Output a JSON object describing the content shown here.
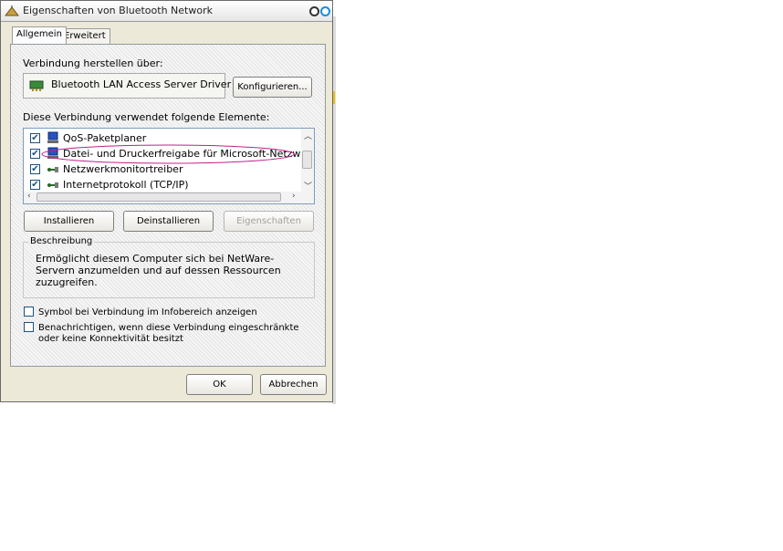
{
  "window": {
    "title": "Eigenschaften von Bluetooth Network"
  },
  "tabs": [
    {
      "label": "Allgemein",
      "active": true
    },
    {
      "label": "Erweitert",
      "active": false
    }
  ],
  "connection": {
    "label": "Verbindung herstellen über:",
    "adapter": "Bluetooth LAN Access Server Driver",
    "configure_button": "Konfigurieren..."
  },
  "elements": {
    "label": "Diese Verbindung verwendet folgende Elemente:",
    "items": [
      {
        "label": "QoS-Paketplaner",
        "checked": true,
        "icon": "network-service-icon"
      },
      {
        "label": "Datei- und Druckerfreigabe für Microsoft-Netzwerke",
        "checked": true,
        "icon": "network-client-icon"
      },
      {
        "label": "Netzwerkmonitortreiber",
        "checked": true,
        "icon": "protocol-icon"
      },
      {
        "label": "Internetprotokoll (TCP/IP)",
        "checked": true,
        "icon": "protocol-icon"
      }
    ]
  },
  "buttons": {
    "install": "Installieren",
    "uninstall": "Deinstallieren",
    "properties": "Eigenschaften",
    "ok": "OK",
    "cancel": "Abbrechen"
  },
  "description": {
    "legend": "Beschreibung",
    "text": "Ermöglicht diesem Computer sich bei NetWare-Servern anzumelden und auf dessen Ressourcen zuzugreifen."
  },
  "options": {
    "show_icon": "Symbol bei Verbindung im Infobereich anzeigen",
    "notify": "Benachrichtigen, wenn diese Verbindung eingeschränkte oder keine Konnektivität besitzt",
    "show_icon_checked": false,
    "notify_checked": false
  },
  "colors": {
    "annotation_ellipse": "#c0208a",
    "titlebar_button_accent": "#1a8ed8"
  }
}
